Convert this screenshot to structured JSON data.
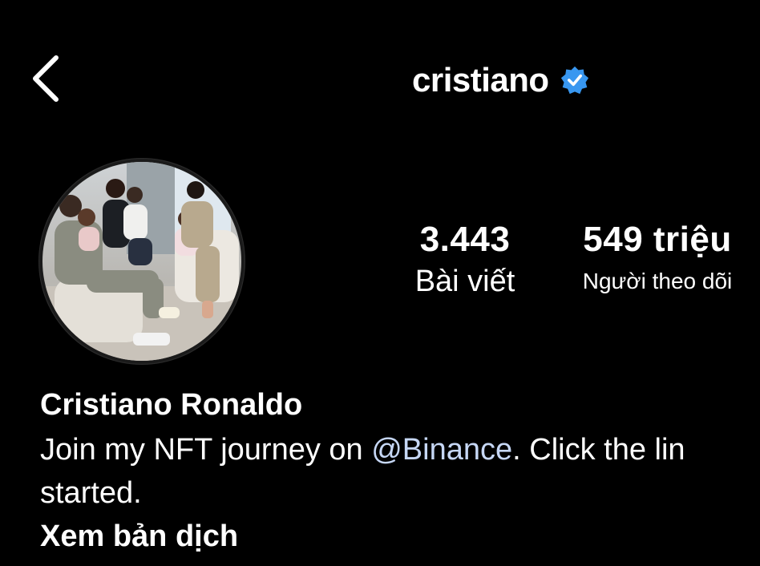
{
  "header": {
    "username": "cristiano",
    "back_icon": "chevron-left-icon",
    "verified_icon": "verified-badge-icon",
    "verified_color": "#3897f0"
  },
  "profile": {
    "avatar_icon": "profile-photo",
    "stats": {
      "posts_count": "3.443",
      "posts_label": "Bài viết",
      "followers_count": "549 triệu",
      "followers_label": "Người theo dõi"
    },
    "name": "Cristiano Ronaldo",
    "bio": {
      "line1_prefix": "Join my NFT journey on ",
      "mention": "@Binance",
      "line1_suffix": ". Click the lin",
      "line2": "started."
    },
    "translate_label": "Xem bản dịch"
  },
  "colors": {
    "background": "#000000",
    "text": "#ffffff",
    "mention": "#c6d7f5"
  }
}
